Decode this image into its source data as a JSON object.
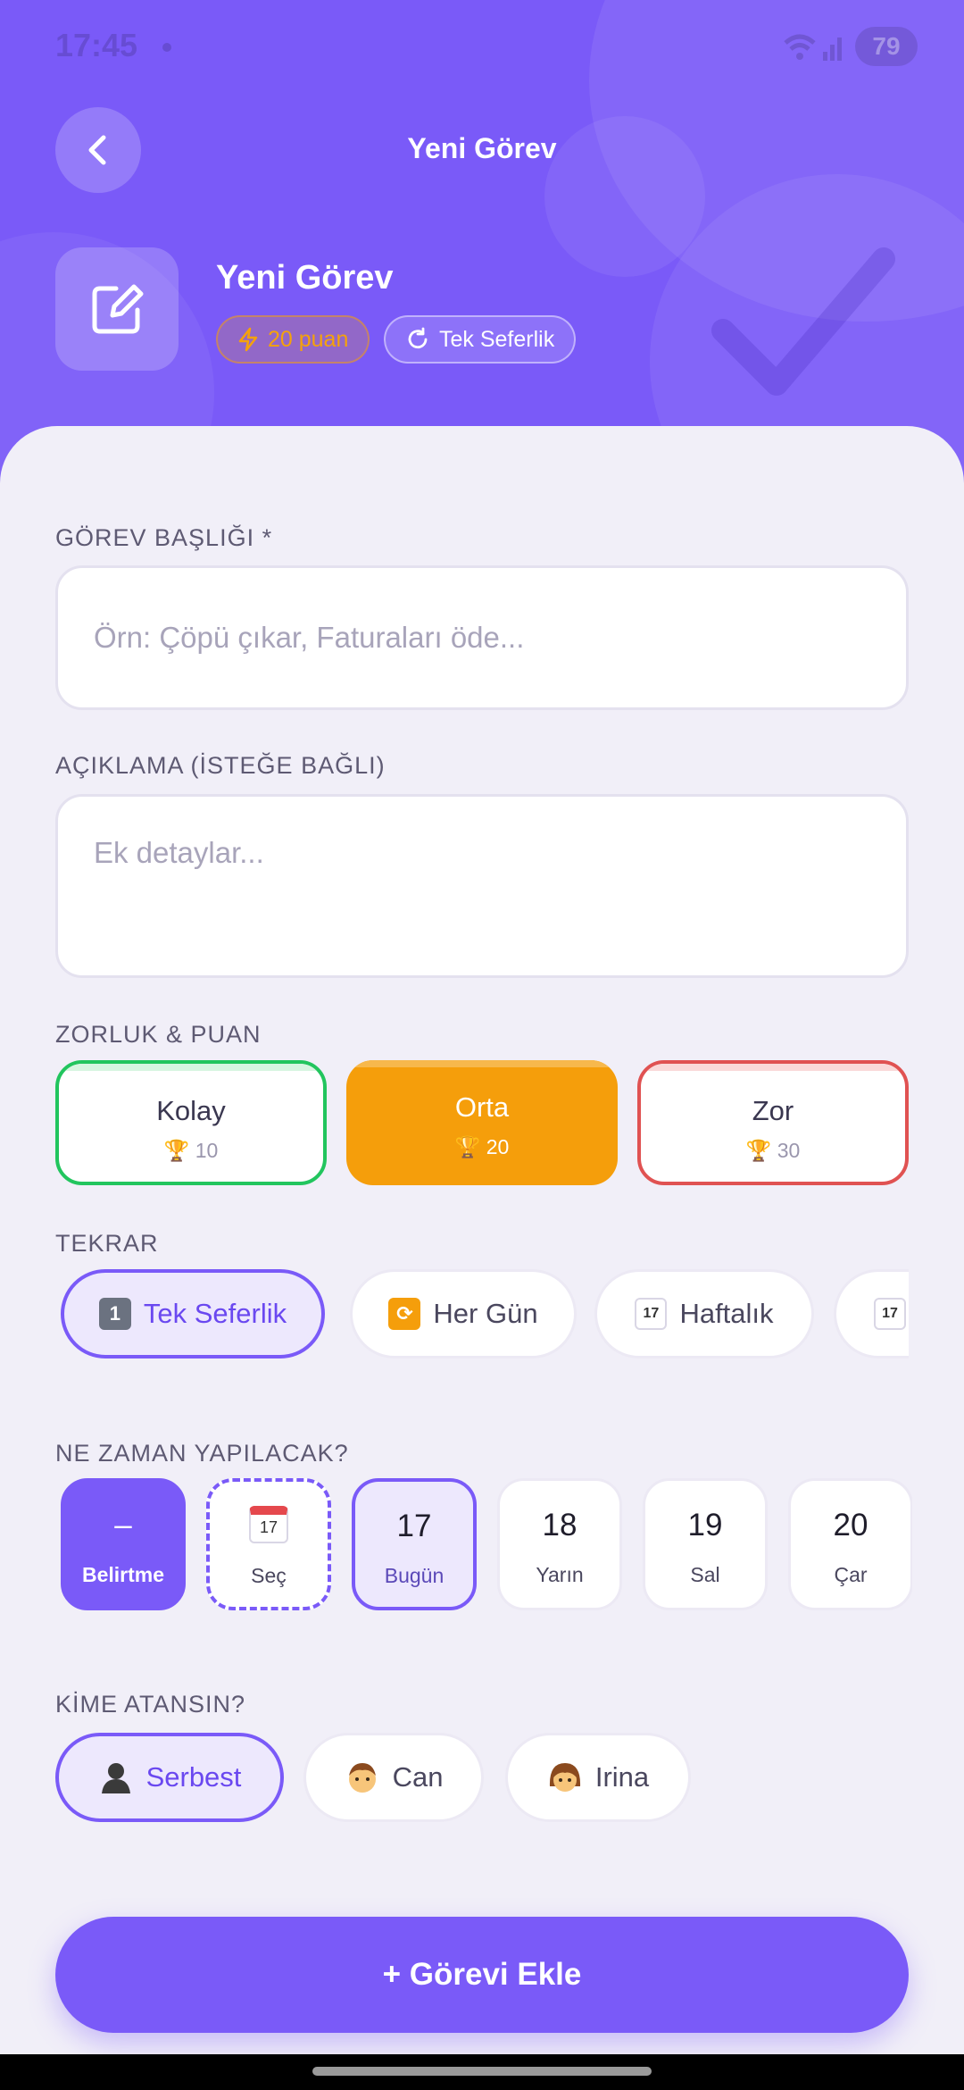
{
  "status_bar": {
    "time": "17:45",
    "battery": "79"
  },
  "header": {
    "title": "Yeni Görev",
    "task_name": "Yeni Görev",
    "points_chip": "20 puan",
    "frequency_chip": "Tek Seferlik",
    "accent_color": "#7A5AF8"
  },
  "form": {
    "title_label": "GÖREV BAŞLIĞI *",
    "title_placeholder": "Örn: Çöpü çıkar, Faturaları öde...",
    "desc_label": "AÇIKLAMA (İSTEĞE BAĞLI)",
    "desc_placeholder": "Ek detaylar...",
    "difficulty_label": "ZORLUK & PUAN",
    "difficulties": [
      {
        "name": "Kolay",
        "points": "10",
        "color": "#22C55E"
      },
      {
        "name": "Orta",
        "points": "20",
        "color": "#F59E0B",
        "selected": true
      },
      {
        "name": "Zor",
        "points": "30",
        "color": "#E05252"
      }
    ],
    "repeat_label": "TEKRAR",
    "repeats": [
      {
        "icon": "keycap-one-icon",
        "label": "Tek Seferlik",
        "selected": true
      },
      {
        "icon": "repeat-arrows-icon",
        "label": "Her Gün"
      },
      {
        "icon": "calendar-icon",
        "label": "Haftalık"
      },
      {
        "icon": "calendar-icon",
        "label": ""
      }
    ],
    "when_label": "NE ZAMAN YAPILACAK?",
    "dates": [
      {
        "num": "–",
        "sub": "Belirtme",
        "selected": true
      },
      {
        "num": "",
        "sub": "Seç",
        "icon": "calendar-icon"
      },
      {
        "num": "17",
        "sub": "Bugün",
        "today": true
      },
      {
        "num": "18",
        "sub": "Yarın"
      },
      {
        "num": "19",
        "sub": "Sal"
      },
      {
        "num": "20",
        "sub": "Çar"
      }
    ],
    "assign_label": "KİME ATANSIN?",
    "assignees": [
      {
        "icon": "person-silhouette-icon",
        "name": "Serbest",
        "selected": true
      },
      {
        "icon": "boy-face-icon",
        "name": "Can"
      },
      {
        "icon": "girl-face-icon",
        "name": "Irina"
      }
    ],
    "submit_label": "+ Görevi Ekle"
  }
}
